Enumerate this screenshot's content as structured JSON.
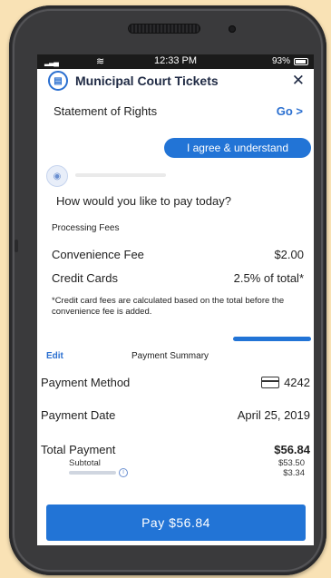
{
  "status_bar": {
    "time": "12:33 PM",
    "battery": "93%"
  },
  "header": {
    "title": "Municipal Court Tickets",
    "close_label": "✕"
  },
  "rights": {
    "label": "Statement of Rights",
    "go_label": "Go >"
  },
  "agree_button_label": "I agree & understand",
  "question": "How would you like to pay today?",
  "fees": {
    "title": "Processing Fees",
    "rows": [
      {
        "label": "Convenience Fee",
        "value": "$2.00"
      },
      {
        "label": "Credit Cards",
        "value": "2.5% of total*"
      }
    ],
    "note": "*Credit card fees are calculated based on the total before the convenience fee is added."
  },
  "summary": {
    "edit_label": "Edit",
    "title": "Payment Summary",
    "method_label": "Payment Method",
    "method_value": "4242",
    "date_label": "Payment Date",
    "date_value": "April 25, 2019",
    "total_label": "Total Payment",
    "total_value": "$56.84",
    "subtotal_label": "Subtotal",
    "subtotal_value": "$53.50",
    "processing_value": "$3.34"
  },
  "pay_button_label": "Pay $56.84",
  "colors": {
    "accent": "#2274d6",
    "background": "#f9e2b5",
    "phone_body": "#3a3a3c"
  }
}
